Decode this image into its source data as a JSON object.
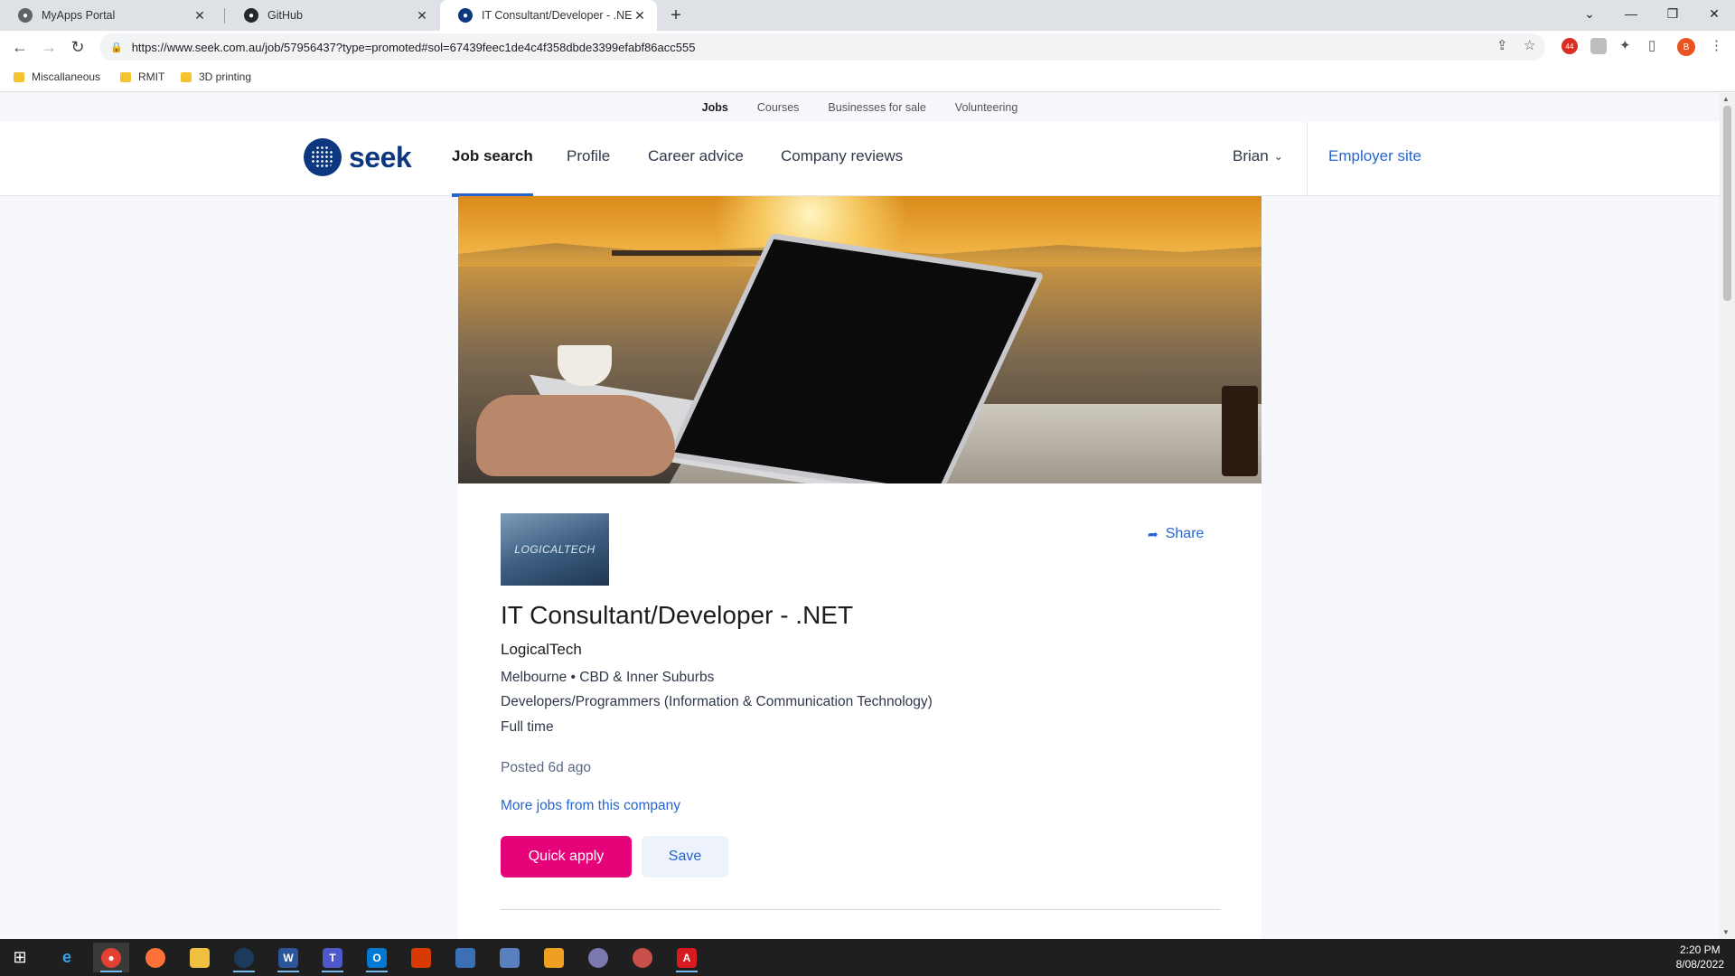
{
  "browser": {
    "tabs": [
      {
        "title": "MyApps Portal",
        "active": false
      },
      {
        "title": "GitHub",
        "active": false
      },
      {
        "title": "IT Consultant/Developer - .NET Jo",
        "active": true
      }
    ],
    "url": "https://www.seek.com.au/job/57956437?type=promoted#sol=67439feec1de4c4f358dbde3399efabf86acc555",
    "profile_initial": "B",
    "extension_badge": "44",
    "bookmarks": [
      "Miscallaneous",
      "RMIT",
      "3D printing"
    ]
  },
  "site": {
    "subnav": [
      "Jobs",
      "Courses",
      "Businesses for sale",
      "Volunteering"
    ],
    "logo_text": "seek",
    "nav": [
      "Job search",
      "Profile",
      "Career advice",
      "Company reviews"
    ],
    "user": "Brian",
    "employer_link": "Employer site"
  },
  "job": {
    "logo_text": "LOGICALTECH",
    "share_label": "Share",
    "title": "IT Consultant/Developer - .NET",
    "company": "LogicalTech",
    "location": "Melbourne • CBD & Inner Suburbs",
    "classification": "Developers/Programmers (Information & Communication Technology)",
    "work_type": "Full time",
    "posted": "Posted 6d ago",
    "more_jobs_link": "More jobs from this company",
    "apply_label": "Quick apply",
    "save_label": "Save"
  },
  "taskbar": {
    "time": "2:20 PM",
    "date": "8/08/2022"
  },
  "colors": {
    "seek_blue": "#0d3880",
    "link_blue": "#2765cf",
    "apply_pink": "#e60278"
  }
}
